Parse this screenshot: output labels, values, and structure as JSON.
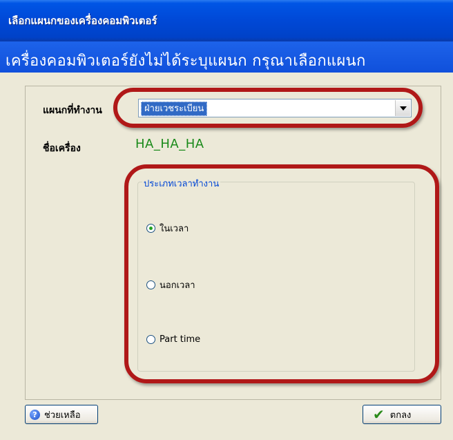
{
  "window": {
    "title": "เลือกแผนกของเครื่องคอมพิวเตอร์"
  },
  "header": {
    "message": "เครื่องคอมพิวเตอร์ยังไม่ได้ระบุแผนก กรุณาเลือกแผนก"
  },
  "form": {
    "department_label": "แผนกที่ทำงาน",
    "department_value": "ฝ่ายเวชระเบียน",
    "machine_label": "ชื่อเครื่อง",
    "machine_value": "HA_HA_HA"
  },
  "work_time": {
    "group_title": "ประเภทเวลาทำงาน",
    "options": [
      {
        "label": "ในเวลา",
        "selected": true
      },
      {
        "label": "นอกเวลา",
        "selected": false
      },
      {
        "label": "Part time",
        "selected": false
      }
    ]
  },
  "buttons": {
    "help_label": "ช่วยเหลือ",
    "ok_label": "ตกลง"
  },
  "icons": {
    "help": "help-icon",
    "ok": "check-icon",
    "combo_arrow": "chevron-down-icon"
  },
  "colors": {
    "titlebar": "#0055e5",
    "machine_name": "#1a8a1a",
    "group_title": "#0046d5",
    "callout": "#b01818"
  }
}
